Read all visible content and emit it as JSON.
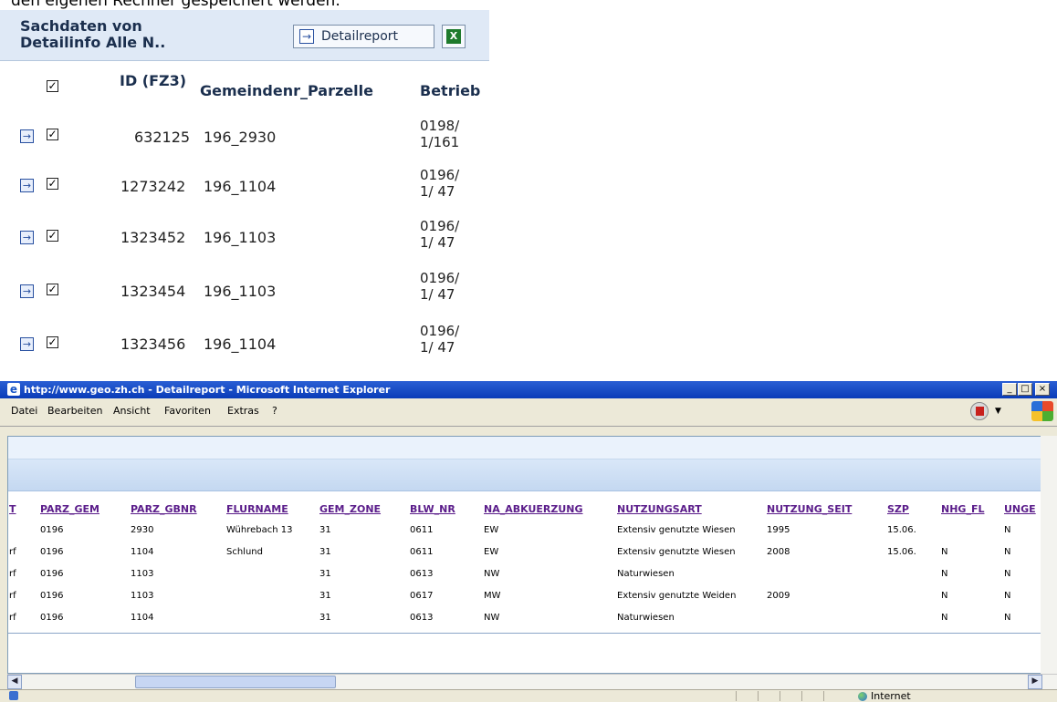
{
  "top_caption": "den eigenen Rechner gespeichert werden.",
  "panel": {
    "title": "Sachdaten von Detailinfo Alle N..",
    "detail_button_label": "Detailreport",
    "columns": [
      "ID (FZ3)",
      "Gemeindenr_Parzelle",
      "Betrieb"
    ],
    "rows": [
      {
        "id": "632125",
        "parzelle": "196_2930",
        "betrieb": "0198/ 1/161"
      },
      {
        "id": "1273242",
        "parzelle": "196_1104",
        "betrieb": "0196/ 1/ 47"
      },
      {
        "id": "1323452",
        "parzelle": "196_1103",
        "betrieb": "0196/ 1/ 47"
      },
      {
        "id": "1323454",
        "parzelle": "196_1103",
        "betrieb": "0196/ 1/ 47"
      },
      {
        "id": "1323456",
        "parzelle": "196_1104",
        "betrieb": "0196/ 1/ 47"
      }
    ]
  },
  "ie": {
    "title": "http://www.geo.zh.ch - Detailreport - Microsoft Internet Explorer",
    "menu": [
      "Datei",
      "Bearbeiten",
      "Ansicht",
      "Favoriten",
      "Extras",
      "?"
    ],
    "window_buttons": [
      "_",
      "□",
      "×"
    ],
    "status_zone": "Internet",
    "table": {
      "columns": [
        "T",
        "PARZ_GEM",
        "PARZ_GBNR",
        "FLURNAME",
        "GEM_ZONE",
        "BLW_NR",
        "NA_ABKUERZUNG",
        "NUTZUNGSART",
        "NUTZUNG_SEIT",
        "SZP",
        "NHG_FL",
        "UNGE"
      ],
      "rows": [
        [
          "",
          "0196",
          "2930",
          "Wührebach 13",
          "31",
          "0611",
          "EW",
          "Extensiv genutzte Wiesen",
          "1995",
          "15.06.",
          "",
          "N"
        ],
        [
          "rf",
          "0196",
          "1104",
          "Schlund",
          "31",
          "0611",
          "EW",
          "Extensiv genutzte Wiesen",
          "2008",
          "15.06.",
          "N",
          "N"
        ],
        [
          "rf",
          "0196",
          "1103",
          "",
          "31",
          "0613",
          "NW",
          "Naturwiesen",
          "",
          "",
          "N",
          "N"
        ],
        [
          "rf",
          "0196",
          "1103",
          "",
          "31",
          "0617",
          "MW",
          "Extensiv genutzte Weiden",
          "2009",
          "",
          "N",
          "N"
        ],
        [
          "rf",
          "0196",
          "1104",
          "",
          "31",
          "0613",
          "NW",
          "Naturwiesen",
          "",
          "",
          "N",
          "N"
        ]
      ]
    }
  }
}
